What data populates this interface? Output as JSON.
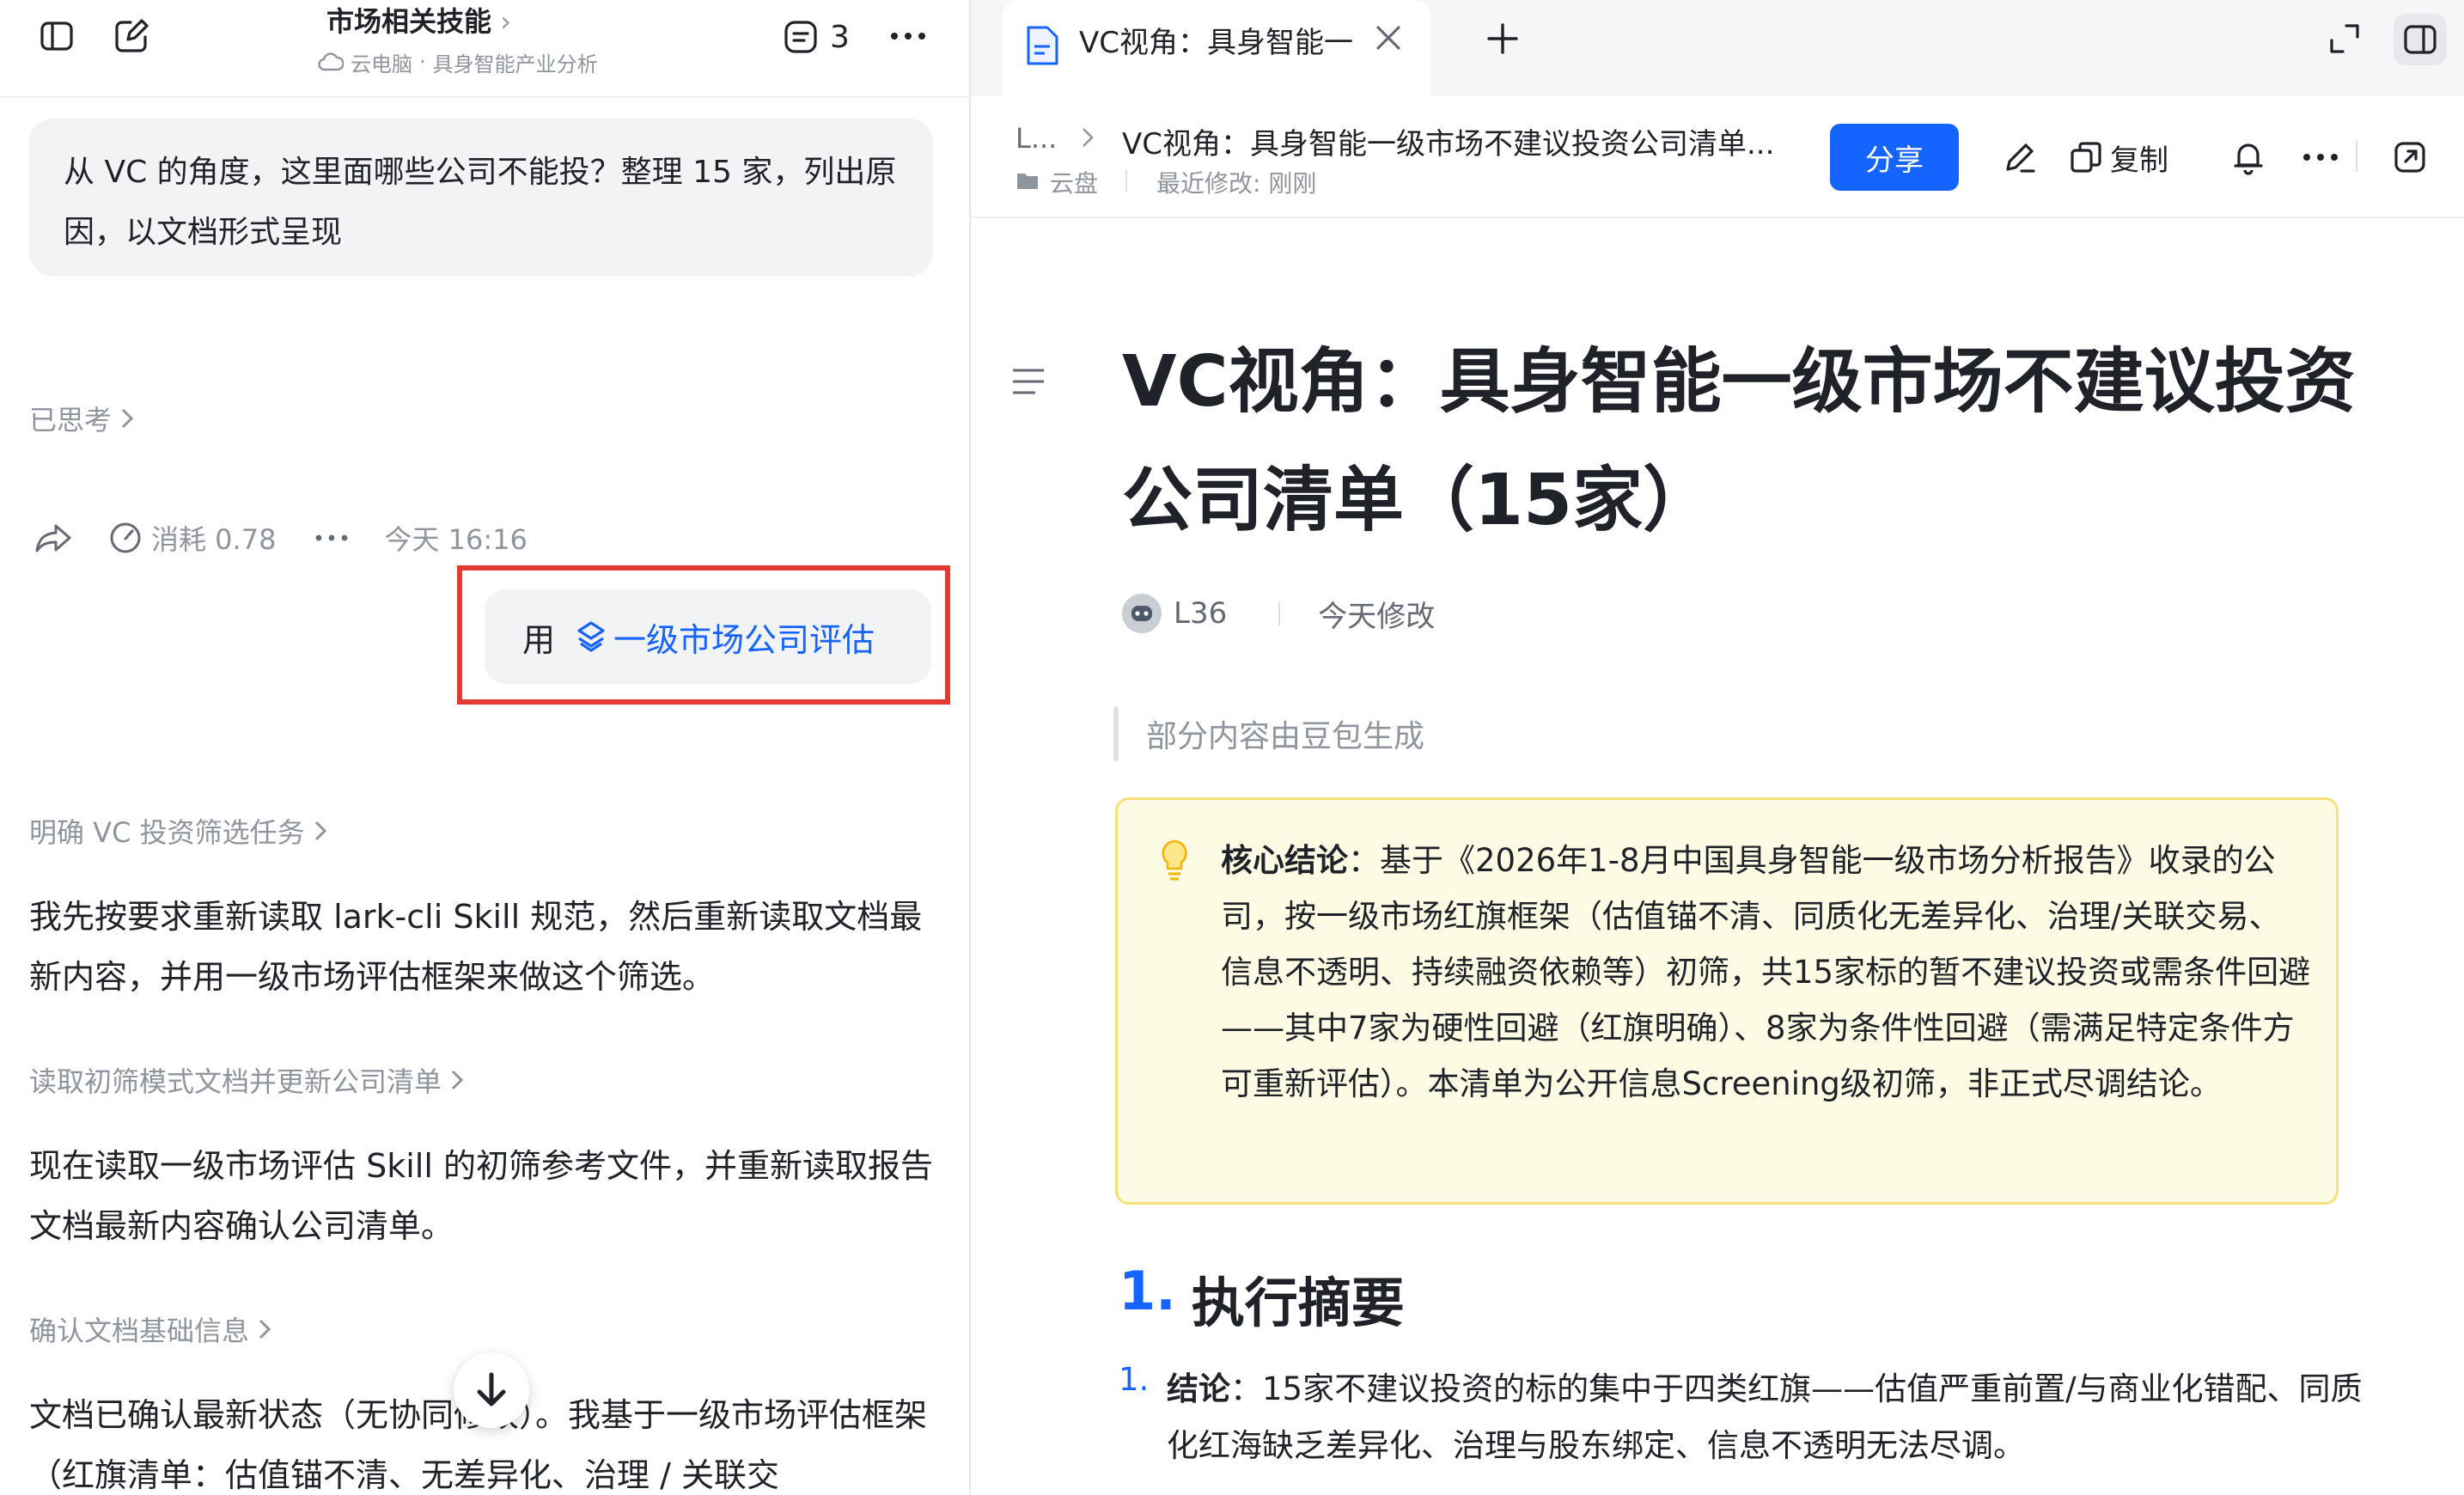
{
  "left_panel": {
    "header": {
      "title": "市场相关技能",
      "subtitle_env": "云电脑",
      "subtitle_sep": "·",
      "subtitle_project": "具身智能产业分析",
      "tasks_count": "3"
    },
    "user_message": "从 VC 的角度，这里面哪些公司不能投？整理 15 家，列出原因，以文档形式呈现",
    "thought_label": "已思考",
    "actions": {
      "cost_label": "消耗 0.78",
      "time_label": "今天 16:16"
    },
    "skill_use": {
      "prefix": "用",
      "skill_name": "一级市场公司评估"
    },
    "steps": [
      {
        "title": "明确 VC 投资筛选任务",
        "text": "我先按要求重新读取 lark-cli Skill 规范，然后重新读取文档最新内容，并用一级市场评估框架来做这个筛选。"
      },
      {
        "title": "读取初筛模式文档并更新公司清单",
        "text": "现在读取一级市场评估 Skill 的初筛参考文件，并重新读取报告文档最新内容确认公司清单。"
      },
      {
        "title": "确认文档基础信息",
        "text": "文档已确认最新状态（无协同修改）。我基于一级市场评估框架（红旗清单：估值锚不清、无差异化、治理 / 关联交"
      }
    ]
  },
  "right_panel": {
    "tab": {
      "label": "VC视角：具身智能一"
    },
    "doc_header": {
      "breadcrumb_root": "L...",
      "breadcrumb_title": "VC视角：具身智能一级市场不建议投资公司清单...",
      "location": "云盘",
      "modified": "最近修改: 刚刚",
      "share_label": "分享",
      "copy_label": "复制"
    },
    "document": {
      "title": "VC视角：具身智能一级市场不建议投资公司清单（15家）",
      "author": "L36",
      "modified": "今天修改",
      "quote": "部分内容由豆包生成",
      "callout_label": "核心结论",
      "callout_text": "：基于《2026年1-8月中国具身智能一级市场分析报告》收录的公司，按一级市场红旗框架（估值锚不清、同质化无差异化、治理/关联交易、信息不透明、持续融资依赖等）初筛，共15家标的暂不建议投资或需条件回避——其中7家为硬性回避（红旗明确）、8家为条件性回避（需满足特定条件方可重新评估）。本清单为公开信息Screening级初筛，非正式尽调结论。",
      "section_number": "1.",
      "section_title": "执行摘要",
      "list_item_number": "1.",
      "list_item_label": "结论",
      "list_item_text": "：15家不建议投资的标的集中于四类红旗——估值严重前置/与商业化错配、同质化红海缺乏差异化、治理与股东绑定、信息不透明无法尽调。"
    }
  },
  "colors": {
    "accent": "#1664ff",
    "highlight_border": "#e53935",
    "callout_bg": "#fefbe5",
    "callout_border": "#f7e07a"
  }
}
